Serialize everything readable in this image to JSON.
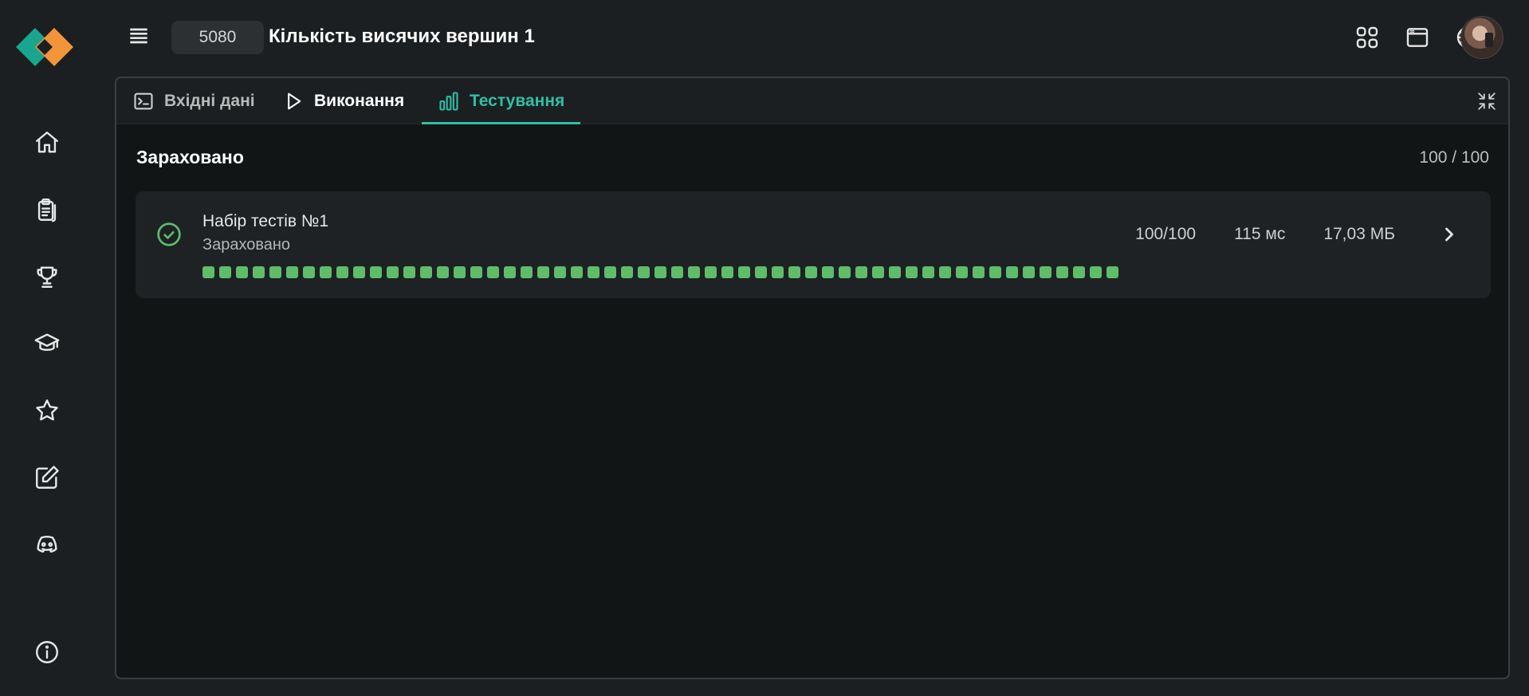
{
  "header": {
    "problem_id": "5080",
    "problem_title": "Кількість висячих вершин 1"
  },
  "sidebar": {
    "items": [
      {
        "icon": "home-icon"
      },
      {
        "icon": "clipboard-icon"
      },
      {
        "icon": "trophy-icon"
      },
      {
        "icon": "graduation-cap-icon"
      },
      {
        "icon": "star-icon"
      },
      {
        "icon": "edit-icon"
      },
      {
        "icon": "discord-icon"
      },
      {
        "icon": "info-icon"
      }
    ]
  },
  "tabs": [
    {
      "label": "Вхідні дані",
      "icon": "terminal-icon"
    },
    {
      "label": "Виконання",
      "icon": "play-icon"
    },
    {
      "label": "Тестування",
      "icon": "bar-chart-icon",
      "active": true
    }
  ],
  "result": {
    "verdict": "Зараховано",
    "score": "100 / 100"
  },
  "test_group": {
    "name": "Набір тестів №1",
    "status": "Зараховано",
    "score": "100/100",
    "time": "115 мс",
    "memory": "17,03 МБ",
    "passed_tests": 55,
    "cell_color": "#5fbd6a"
  },
  "colors": {
    "accent": "#2fbfa6",
    "success": "#5fbd6a",
    "logo_teal": "#1aa58e",
    "logo_orange": "#f2953a"
  }
}
